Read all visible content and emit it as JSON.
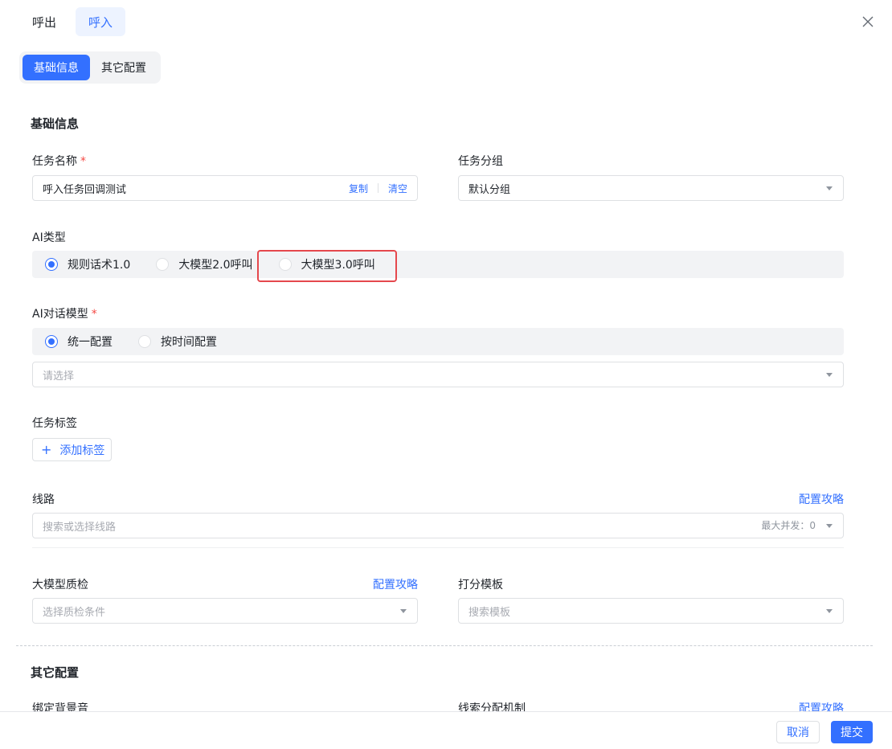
{
  "top_tabs": [
    {
      "label": "呼出"
    },
    {
      "label": "呼入"
    }
  ],
  "segment": [
    {
      "label": "基础信息"
    },
    {
      "label": "其它配置"
    }
  ],
  "basic": {
    "title": "基础信息",
    "task_name": {
      "label": "任务名称",
      "required": "*",
      "value": "呼入任务回调测试",
      "copy": "复制",
      "clear": "清空"
    },
    "task_group": {
      "label": "任务分组",
      "value": "默认分组"
    },
    "ai_type": {
      "label": "AI类型",
      "options": [
        {
          "label": "规则话术1.0"
        },
        {
          "label": "大模型2.0呼叫"
        },
        {
          "label": "大模型3.0呼叫"
        }
      ],
      "selected_index": 0
    },
    "dialog_model": {
      "label": "AI对话模型",
      "required": "*",
      "options": [
        {
          "label": "统一配置"
        },
        {
          "label": "按时间配置"
        }
      ],
      "selected_index": 0,
      "placeholder": "请选择"
    },
    "task_tags": {
      "label": "任务标签",
      "add_label": "添加标签"
    },
    "route": {
      "label": "线路",
      "guide": "配置攻略",
      "placeholder": "搜索或选择线路",
      "max_concurrency": "最大并发：0"
    },
    "qc": {
      "label": "大模型质检",
      "guide": "配置攻略",
      "placeholder": "选择质检条件"
    },
    "score_template": {
      "label": "打分模板",
      "placeholder": "搜索模板"
    }
  },
  "other": {
    "title": "其它配置",
    "bg_music": {
      "label": "绑定背景音"
    },
    "lead_dist": {
      "label": "线索分配机制",
      "guide": "配置攻略"
    }
  },
  "footer": {
    "cancel": "取消",
    "submit": "提交"
  },
  "colors": {
    "primary": "#3370ff",
    "required": "#f54a45",
    "highlight": "#e5484d"
  }
}
